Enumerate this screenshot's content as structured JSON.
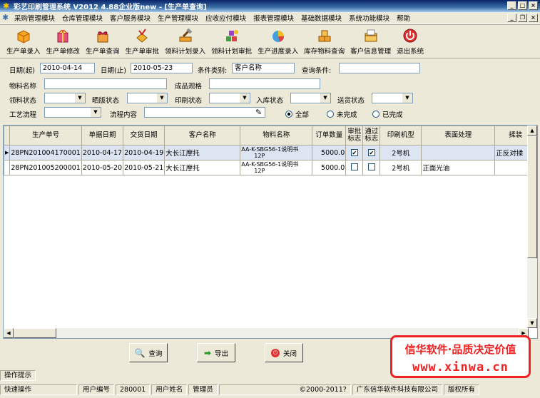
{
  "window": {
    "title": "彩艺印刷管理系统  V2012 4.88企业版new - [生产单查询]"
  },
  "menu": [
    "采购管理模块",
    "仓库管理模块",
    "客户服务模块",
    "生产管理模块",
    "应收应付模块",
    "报表管理模块",
    "基础数据模块",
    "系统功能模块",
    "帮助"
  ],
  "toolbar": [
    "生产单录入",
    "生产单修改",
    "生产单查询",
    "生产单审批",
    "领料计划录入",
    "领料计划审批",
    "生产进度录入",
    "库存物料查询",
    "客户信息管理",
    "退出系统"
  ],
  "filters": {
    "date_start_label": "日期(起)",
    "date_start": "2010-04-14",
    "date_end_label": "日期(止)",
    "date_end": "2010-05-23",
    "condition_type_label": "条件类别:",
    "condition_type": "客户名称",
    "condition_label": "查询条件:",
    "material_name_label": "物料名称",
    "product_spec_label": "成品规格",
    "picking_status_label": "领料状态",
    "plate_status_label": "晒版状态",
    "print_status_label": "印刷状态",
    "warehouse_status_label": "入库状态",
    "delivery_status_label": "送货状态",
    "process_flow_label": "工艺流程",
    "process_content_label": "流程内容",
    "radio_all": "全部",
    "radio_incomplete": "未完成",
    "radio_complete": "已完成"
  },
  "table": {
    "headers": [
      "生产单号",
      "单据日期",
      "交货日期",
      "客户名称",
      "物料名称",
      "订单数量",
      "审批标志",
      "通过标志",
      "印刷机型",
      "表面处理",
      "揉装"
    ],
    "rows": [
      {
        "order_no": "28PN201004170001",
        "doc_date": "2010-04-17",
        "delivery_date": "2010-04-19",
        "customer": "大长江摩托",
        "material_1": "AA-K-SBG56-1说明书",
        "material_2": "12P",
        "qty": "5000.0",
        "approved": true,
        "passed": true,
        "press": "2号机",
        "surface": "",
        "binding": "正反对揉"
      },
      {
        "order_no": "28PN201005200001",
        "doc_date": "2010-05-20",
        "delivery_date": "2010-05-21",
        "customer": "大长江摩托",
        "material_1": "AA-K-SBG56-1说明书",
        "material_2": "12P",
        "qty": "5000.0",
        "approved": false,
        "passed": false,
        "press": "2号机",
        "surface": "正面光油",
        "binding": ""
      }
    ]
  },
  "buttons": {
    "query": "查询",
    "export": "导出",
    "close": "关闭"
  },
  "logo": {
    "line1": "信华软件·品质决定价值",
    "line2": "www.xinwa.cn"
  },
  "status": {
    "op_hint": "操作提示",
    "quick_op": "快速操作",
    "user_no_label": "用户编号",
    "user_no": "280001",
    "user_name_label": "用户姓名",
    "user_name": "管理员",
    "copyright": "©2000-2011?",
    "company": "广东信华软件科技有限公司",
    "rights": "版权所有"
  },
  "colors": {
    "title_bar": "#0a246a",
    "selected_row": "#dde4f2",
    "logo_red": "#e22222"
  }
}
